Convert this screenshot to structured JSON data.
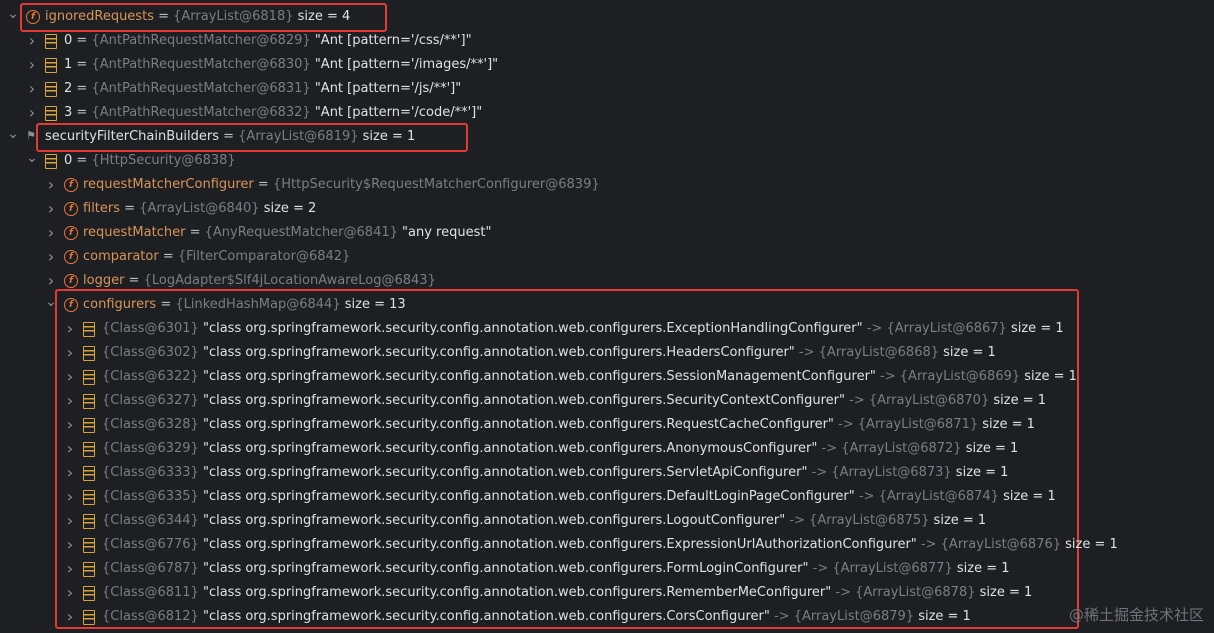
{
  "rows": [
    {
      "kind": "field",
      "expanded": true,
      "name": "ignoredRequests",
      "eq": " = ",
      "ref": "{ArrayList@6818}",
      "size": "  size = 4"
    },
    {
      "kind": "item",
      "expanded": false,
      "name": "0",
      "eq": " = ",
      "ref": "{AntPathRequestMatcher@6829}",
      "val": " \"Ant [pattern='/css/**']\""
    },
    {
      "kind": "item",
      "expanded": false,
      "name": "1",
      "eq": " = ",
      "ref": "{AntPathRequestMatcher@6830}",
      "val": " \"Ant [pattern='/images/**']\""
    },
    {
      "kind": "item",
      "expanded": false,
      "name": "2",
      "eq": " = ",
      "ref": "{AntPathRequestMatcher@6831}",
      "val": " \"Ant [pattern='/js/**']\""
    },
    {
      "kind": "item",
      "expanded": false,
      "name": "3",
      "eq": " = ",
      "ref": "{AntPathRequestMatcher@6832}",
      "val": " \"Ant [pattern='/code/**']\""
    },
    {
      "kind": "flag",
      "expanded": true,
      "name": "securityFilterChainBuilders",
      "eq": " = ",
      "ref": "{ArrayList@6819}",
      "size": "  size = 1"
    },
    {
      "kind": "item",
      "expanded": true,
      "name": "0",
      "eq": " = ",
      "ref": "{HttpSecurity@6838}"
    },
    {
      "kind": "field",
      "expanded": false,
      "name": "requestMatcherConfigurer",
      "eq": " = ",
      "ref": "{HttpSecurity$RequestMatcherConfigurer@6839}"
    },
    {
      "kind": "field",
      "expanded": false,
      "name": "filters",
      "eq": " = ",
      "ref": "{ArrayList@6840}",
      "size": "  size = 2"
    },
    {
      "kind": "field",
      "expanded": false,
      "name": "requestMatcher",
      "eq": " = ",
      "ref": "{AnyRequestMatcher@6841}",
      "val": " \"any request\""
    },
    {
      "kind": "field",
      "expanded": false,
      "name": "comparator",
      "eq": " = ",
      "ref": "{FilterComparator@6842}"
    },
    {
      "kind": "field",
      "expanded": false,
      "name": "logger",
      "eq": " = ",
      "ref": "{LogAdapter$Slf4jLocationAwareLog@6843}"
    },
    {
      "kind": "field",
      "expanded": true,
      "name": "configurers",
      "eq": " = ",
      "ref": "{LinkedHashMap@6844}",
      "size": "  size = 13"
    },
    {
      "kind": "entry",
      "expanded": false,
      "ref": "{Class@6301}",
      "val": " \"class org.springframework.security.config.annotation.web.configurers.ExceptionHandlingConfigurer\"",
      "op": " -> ",
      "ref2": "{ArrayList@6867}",
      "size": "  size = 1"
    },
    {
      "kind": "entry",
      "expanded": false,
      "ref": "{Class@6302}",
      "val": " \"class org.springframework.security.config.annotation.web.configurers.HeadersConfigurer\"",
      "op": " -> ",
      "ref2": "{ArrayList@6868}",
      "size": "  size = 1"
    },
    {
      "kind": "entry",
      "expanded": false,
      "ref": "{Class@6322}",
      "val": " \"class org.springframework.security.config.annotation.web.configurers.SessionManagementConfigurer\"",
      "op": " -> ",
      "ref2": "{ArrayList@6869}",
      "size": "  size = 1"
    },
    {
      "kind": "entry",
      "expanded": false,
      "ref": "{Class@6327}",
      "val": " \"class org.springframework.security.config.annotation.web.configurers.SecurityContextConfigurer\"",
      "op": " -> ",
      "ref2": "{ArrayList@6870}",
      "size": "  size = 1"
    },
    {
      "kind": "entry",
      "expanded": false,
      "ref": "{Class@6328}",
      "val": " \"class org.springframework.security.config.annotation.web.configurers.RequestCacheConfigurer\"",
      "op": " -> ",
      "ref2": "{ArrayList@6871}",
      "size": "  size = 1"
    },
    {
      "kind": "entry",
      "expanded": false,
      "ref": "{Class@6329}",
      "val": " \"class org.springframework.security.config.annotation.web.configurers.AnonymousConfigurer\"",
      "op": " -> ",
      "ref2": "{ArrayList@6872}",
      "size": "  size = 1"
    },
    {
      "kind": "entry",
      "expanded": false,
      "ref": "{Class@6333}",
      "val": " \"class org.springframework.security.config.annotation.web.configurers.ServletApiConfigurer\"",
      "op": " -> ",
      "ref2": "{ArrayList@6873}",
      "size": "  size = 1"
    },
    {
      "kind": "entry",
      "expanded": false,
      "ref": "{Class@6335}",
      "val": " \"class org.springframework.security.config.annotation.web.configurers.DefaultLoginPageConfigurer\"",
      "op": " -> ",
      "ref2": "{ArrayList@6874}",
      "size": "  size = 1"
    },
    {
      "kind": "entry",
      "expanded": false,
      "ref": "{Class@6344}",
      "val": " \"class org.springframework.security.config.annotation.web.configurers.LogoutConfigurer\"",
      "op": " -> ",
      "ref2": "{ArrayList@6875}",
      "size": "  size = 1"
    },
    {
      "kind": "entry",
      "expanded": false,
      "ref": "{Class@6776}",
      "val": " \"class org.springframework.security.config.annotation.web.configurers.ExpressionUrlAuthorizationConfigurer\"",
      "op": " -> ",
      "ref2": "{ArrayList@6876}",
      "size": "  size = 1"
    },
    {
      "kind": "entry",
      "expanded": false,
      "ref": "{Class@6787}",
      "val": " \"class org.springframework.security.config.annotation.web.configurers.FormLoginConfigurer\"",
      "op": " -> ",
      "ref2": "{ArrayList@6877}",
      "size": "  size = 1"
    },
    {
      "kind": "entry",
      "expanded": false,
      "ref": "{Class@6811}",
      "val": " \"class org.springframework.security.config.annotation.web.configurers.RememberMeConfigurer\"",
      "op": " -> ",
      "ref2": "{ArrayList@6878}",
      "size": "  size = 1"
    },
    {
      "kind": "entry",
      "expanded": false,
      "ref": "{Class@6812}",
      "val": " \"class org.springframework.security.config.annotation.web.configurers.CorsConfigurer\"",
      "op": " -> ",
      "ref2": "{ArrayList@6879}",
      "size": "  size = 1"
    }
  ],
  "watermark": "@稀土掘金技术社区",
  "colors": {
    "background": "#1e1f22",
    "field_name": "#d8955b",
    "reference": "#7a7e85",
    "value": "#dfe1e5",
    "highlight_box": "#e53935",
    "field_icon": "#e8773a",
    "element_icon": "#d6a53a"
  },
  "icons": {
    "field": "field-icon",
    "item": "array-element-icon",
    "flag": "flag-icon",
    "expanded": "chevron-down-icon",
    "collapsed": "chevron-right-icon"
  }
}
